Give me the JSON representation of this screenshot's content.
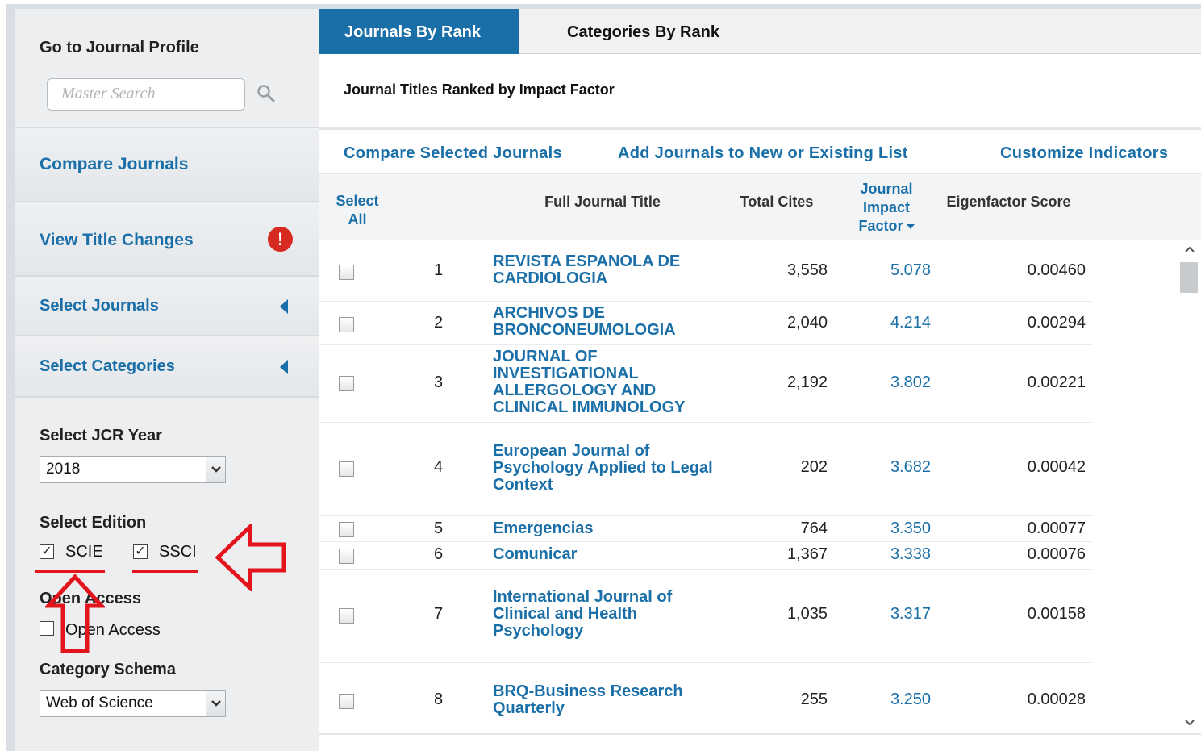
{
  "sidebar": {
    "goto_heading": "Go to Journal Profile",
    "search_placeholder": "Master Search",
    "compare_journals": "Compare Journals",
    "view_title_changes": "View Title Changes",
    "alert_glyph": "!",
    "select_journals": "Select Journals",
    "select_categories": "Select Categories",
    "jcr_year_heading": "Select JCR Year",
    "jcr_year_value": "2018",
    "edition_heading": "Select Edition",
    "edition_options": [
      {
        "label": "SCIE",
        "checked": true
      },
      {
        "label": "SSCI",
        "checked": true
      }
    ],
    "open_access_heading": "Open Access",
    "open_access_option": {
      "label": "Open Access",
      "checked": false
    },
    "schema_heading": "Category Schema",
    "schema_value": "Web of Science"
  },
  "tabs": {
    "active": "Journals By Rank",
    "inactive": "Categories By Rank"
  },
  "ranked_title": "Journal Titles Ranked by Impact Factor",
  "actions": {
    "compare": "Compare Selected Journals",
    "add": "Add Journals to New or Existing List",
    "customize": "Customize Indicators"
  },
  "table": {
    "headers": {
      "select_all_1": "Select",
      "select_all_2": "All",
      "title": "Full Journal Title",
      "cites": "Total Cites",
      "jif_1": "Journal",
      "jif_2": "Impact",
      "jif_3": "Factor",
      "eigen": "Eigenfactor Score"
    },
    "rows": [
      {
        "rank": "1",
        "title": "REVISTA ESPANOLA DE CARDIOLOGIA",
        "cites": "3,558",
        "jif": "5.078",
        "eigen": "0.00460"
      },
      {
        "rank": "2",
        "title": "ARCHIVOS DE BRONCONEUMOLOGIA",
        "cites": "2,040",
        "jif": "4.214",
        "eigen": "0.00294"
      },
      {
        "rank": "3",
        "title": "JOURNAL OF INVESTIGATIONAL ALLERGOLOGY AND CLINICAL IMMUNOLOGY",
        "cites": "2,192",
        "jif": "3.802",
        "eigen": "0.00221"
      },
      {
        "rank": "4",
        "title": "European Journal of Psychology Applied to Legal Context",
        "cites": "202",
        "jif": "3.682",
        "eigen": "0.00042"
      },
      {
        "rank": "5",
        "title": "Emergencias",
        "cites": "764",
        "jif": "3.350",
        "eigen": "0.00077"
      },
      {
        "rank": "6",
        "title": "Comunicar",
        "cites": "1,367",
        "jif": "3.338",
        "eigen": "0.00076"
      },
      {
        "rank": "7",
        "title": "International Journal of Clinical and Health Psychology",
        "cites": "1,035",
        "jif": "3.317",
        "eigen": "0.00158"
      },
      {
        "rank": "8",
        "title": "BRQ-Business Research Quarterly",
        "cites": "255",
        "jif": "3.250",
        "eigen": "0.00028"
      }
    ]
  },
  "colors": {
    "accent": "#1a6fa8",
    "annotation_red": "#e3141b",
    "alert_red": "#d72a20"
  }
}
